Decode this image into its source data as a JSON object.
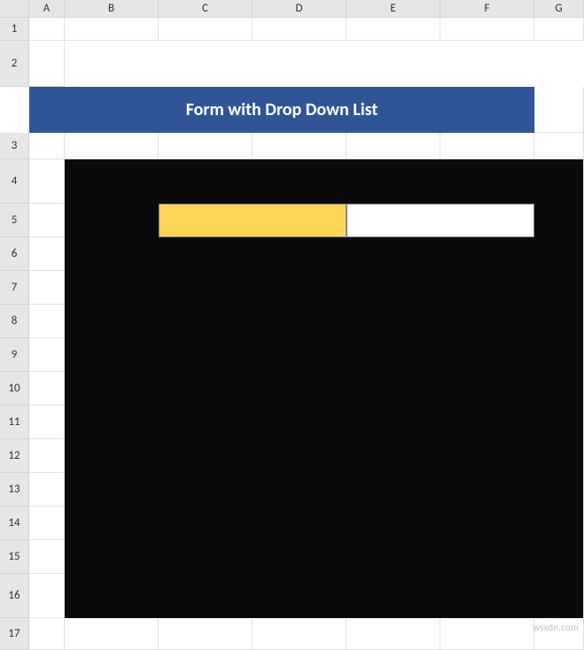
{
  "columns": [
    "A",
    "B",
    "C",
    "D",
    "E",
    "F",
    "G"
  ],
  "rows": [
    "1",
    "2",
    "3",
    "4",
    "5",
    "6",
    "7",
    "8",
    "9",
    "10",
    "11",
    "12",
    "13",
    "14",
    "15",
    "16",
    "17"
  ],
  "title": "Form with Drop Down List",
  "colors": {
    "headerBlue": "#2f5597",
    "panelBlack": "#0a0a0a",
    "highlightYellow": "#ffd558",
    "inputWhite": "#ffffff"
  },
  "form": {
    "labelCell": "",
    "inputCell": ""
  },
  "watermark": "wsxdn.com"
}
